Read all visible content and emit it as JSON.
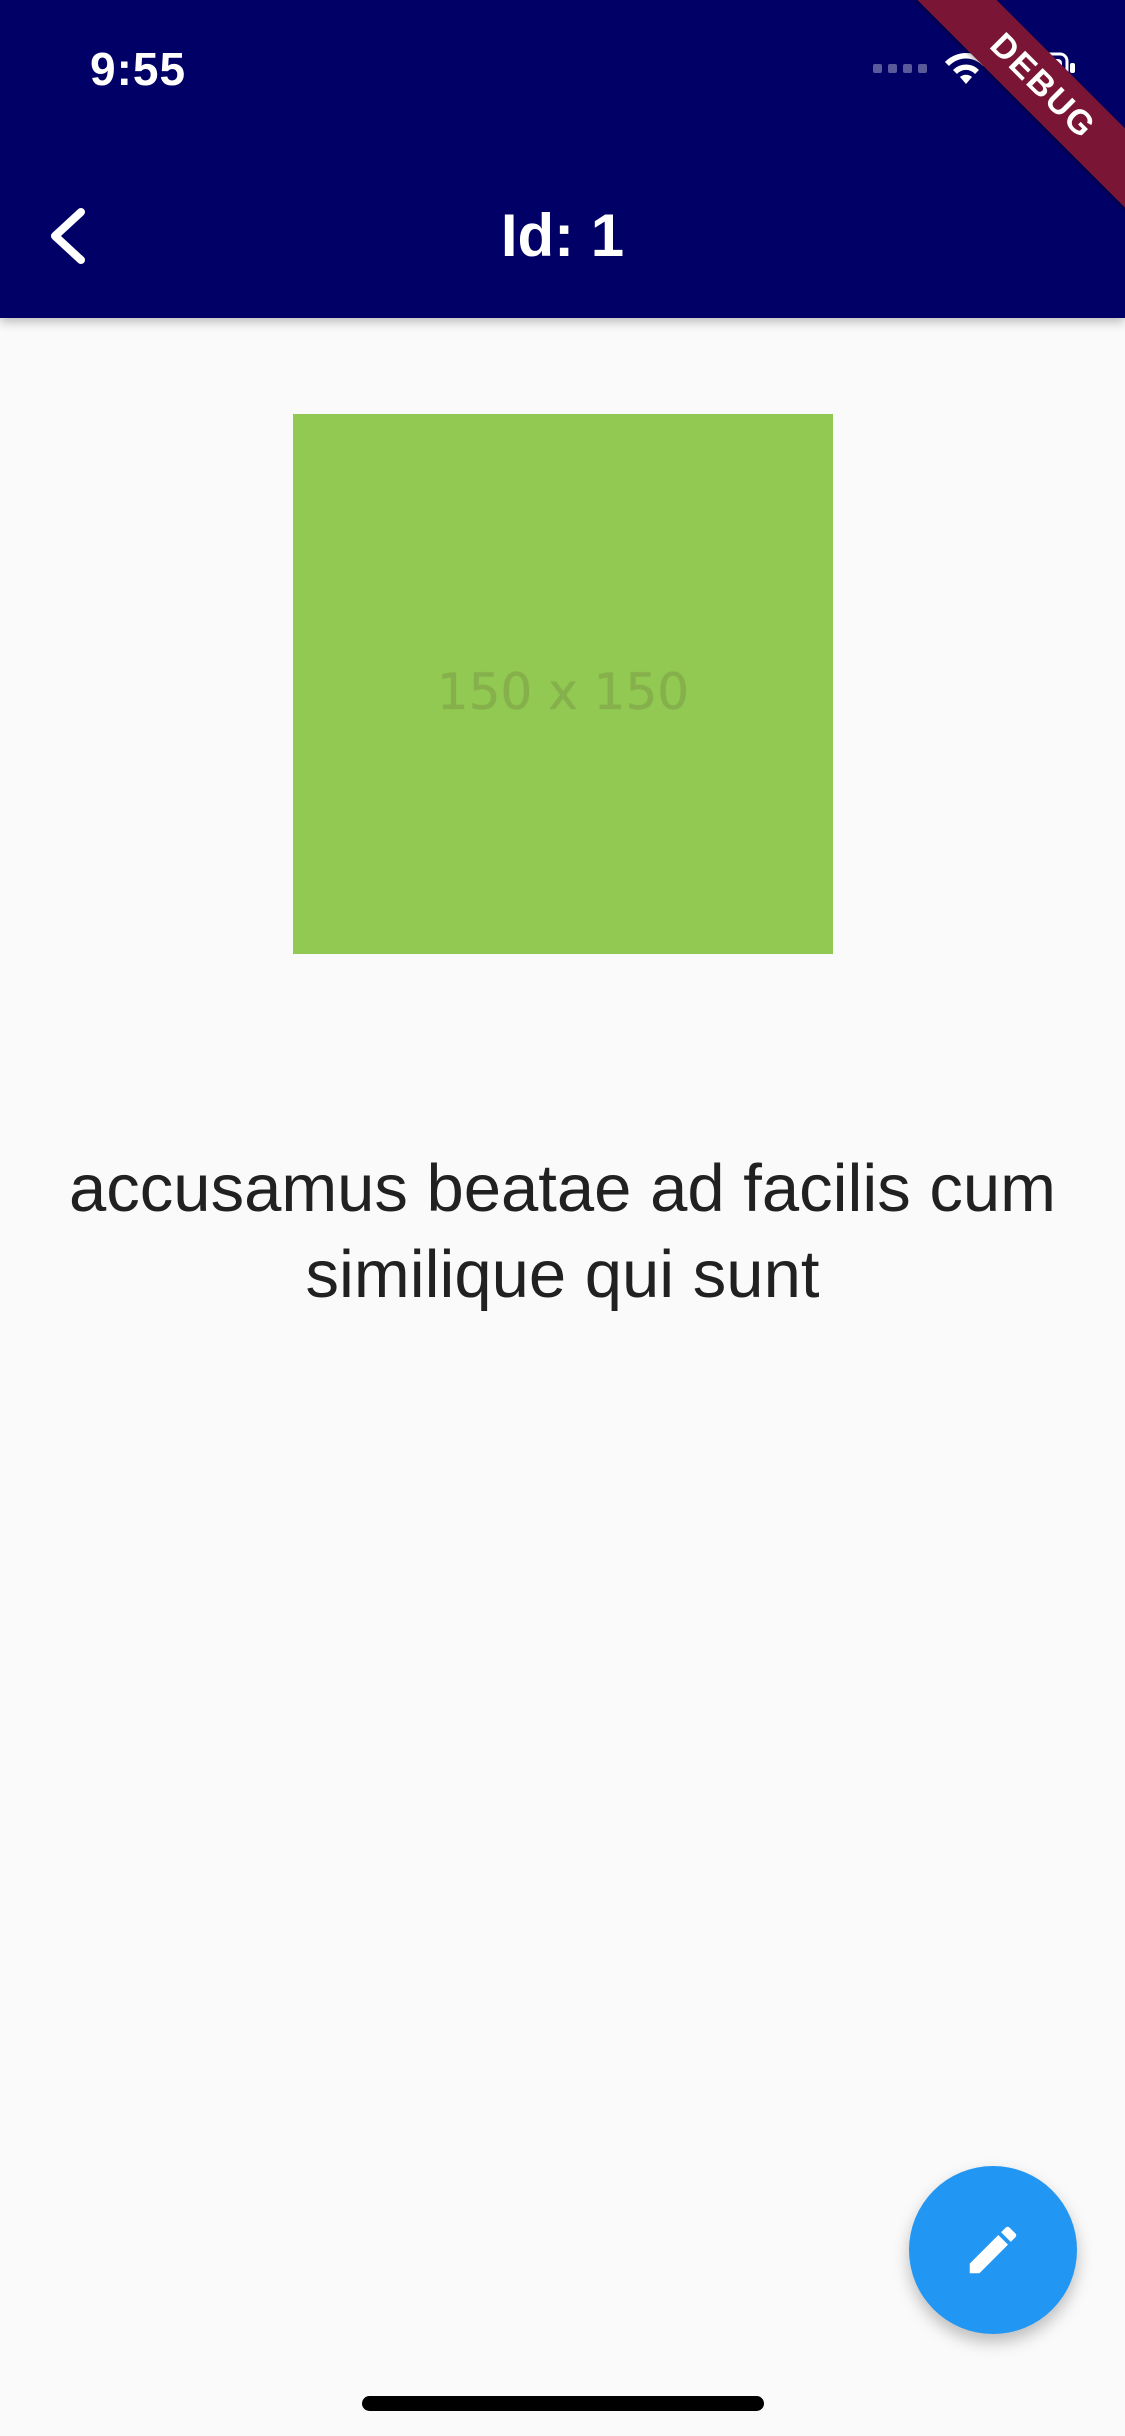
{
  "status_bar": {
    "time": "9:55",
    "icons": [
      "signal-icon",
      "wifi-icon",
      "battery-icon"
    ]
  },
  "app_bar": {
    "title": "Id: 1",
    "back_icon": "chevron-left-icon",
    "background_color": "#000066"
  },
  "debug_banner": {
    "label": "DEBUG",
    "color": "#7a1535"
  },
  "photo": {
    "placeholder_text": "150 x 150",
    "background_color": "#92c952"
  },
  "content": {
    "title": "accusamus beatae ad facilis cum similique qui sunt"
  },
  "fab": {
    "icon": "edit-icon",
    "color": "#2196f3"
  }
}
